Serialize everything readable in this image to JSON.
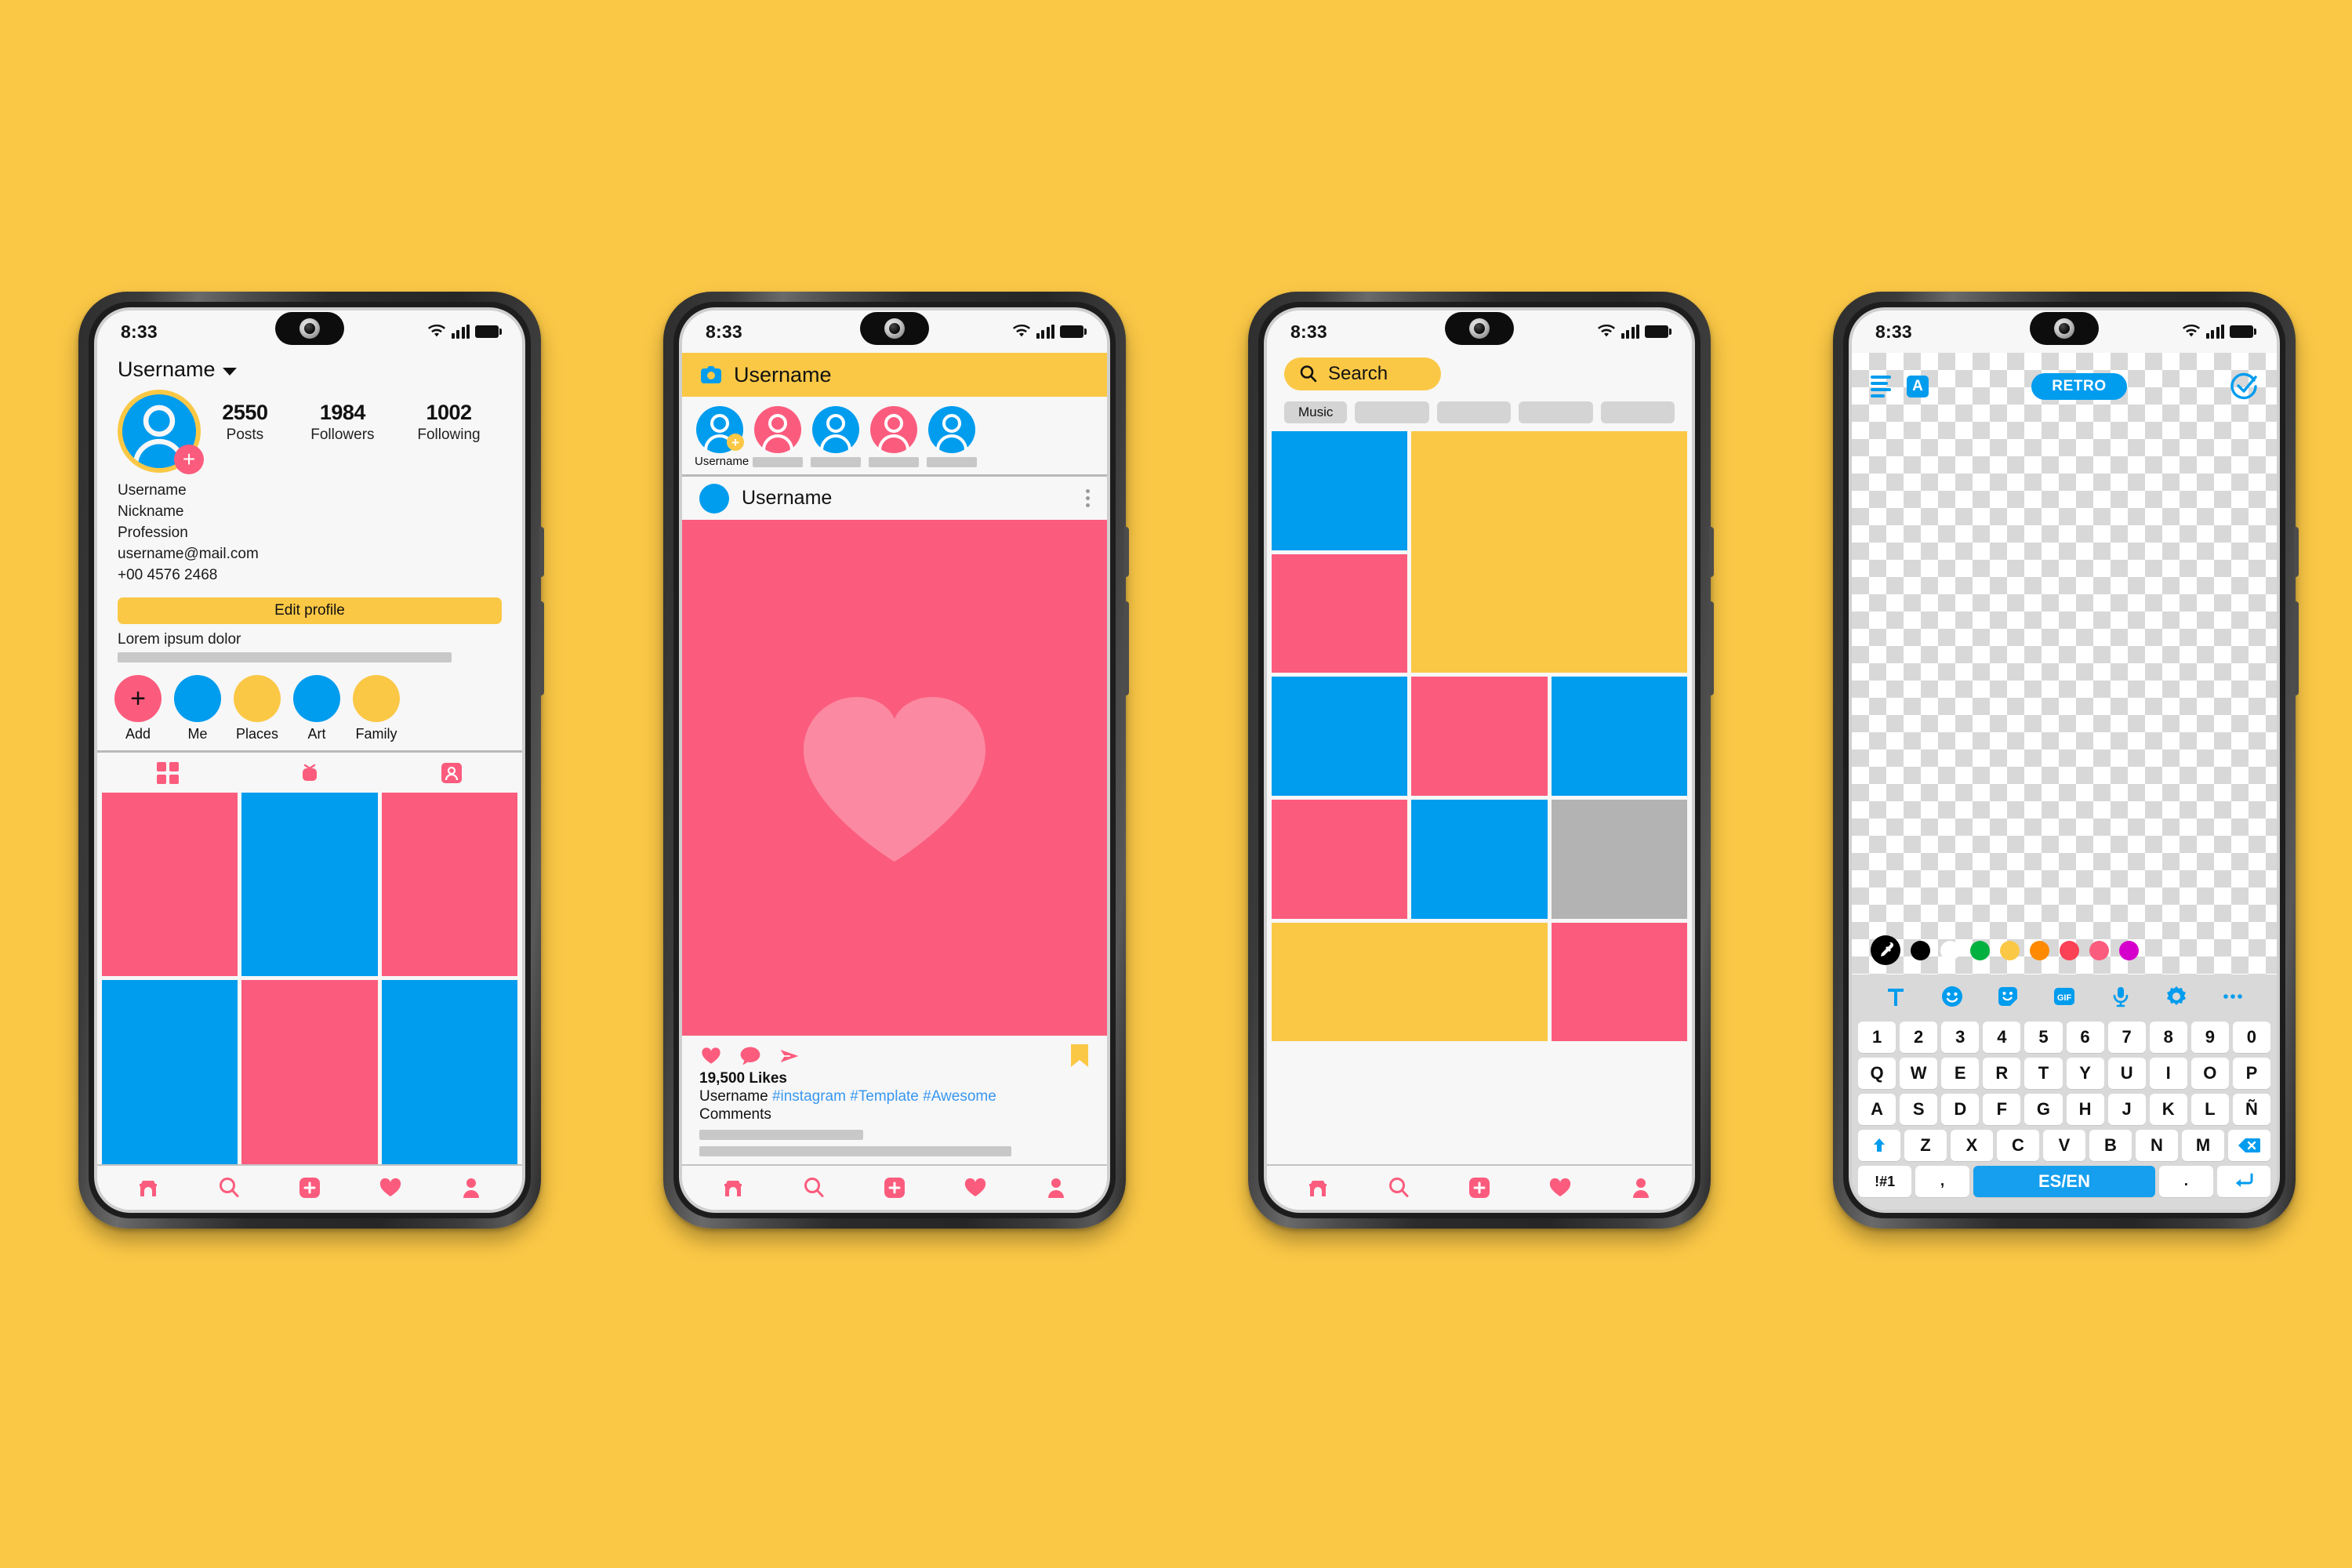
{
  "background_color": "#FBC846",
  "palette": {
    "yellow": "#FBC846",
    "pink": "#FB5C7D",
    "blue": "#009CEE",
    "gray": "#B3B3B3",
    "link_blue": "#3897F0"
  },
  "status_bar": {
    "time": "8:33",
    "icons": [
      "wifi-icon",
      "signal-icon",
      "battery-icon"
    ]
  },
  "phone1": {
    "name": "profile-screen",
    "username_header": "Username",
    "chevron": "chevron-down-icon",
    "avatar": {
      "icon": "user-avatar-icon",
      "add_badge": "+"
    },
    "stats": [
      {
        "number": "2550",
        "label": "Posts"
      },
      {
        "number": "1984",
        "label": "Followers"
      },
      {
        "number": "1002",
        "label": "Following"
      }
    ],
    "meta": [
      "Username",
      "Nickname",
      "Profession",
      "username@mail.com",
      "+00 4576 2468"
    ],
    "edit_button": "Edit profile",
    "bio_title": "Lorem ipsum dolor",
    "highlights": [
      {
        "label": "Add",
        "color": "#FB5C7D",
        "glyph": "+"
      },
      {
        "label": "Me",
        "color": "#009CEE",
        "glyph": ""
      },
      {
        "label": "Places",
        "color": "#FBC846",
        "glyph": ""
      },
      {
        "label": "Art",
        "color": "#009CEE",
        "glyph": ""
      },
      {
        "label": "Family",
        "color": "#FBC846",
        "glyph": ""
      }
    ],
    "tabs": [
      "grid-icon",
      "tv-icon",
      "tagged-person-icon"
    ],
    "grid_colors": [
      "#FB5C7D",
      "#009CEE",
      "#FB5C7D",
      "#009CEE",
      "#FB5C7D",
      "#009CEE"
    ],
    "bottom_nav": [
      "home-icon",
      "search-icon",
      "add-post-icon",
      "heart-icon",
      "profile-icon"
    ]
  },
  "phone2": {
    "name": "feed-screen",
    "header": {
      "icon": "camera-icon",
      "username": "Username"
    },
    "stories": [
      {
        "label": "Username",
        "color": "#009CEE",
        "has_add": true
      },
      {
        "label": "",
        "color": "#FB5C7D",
        "has_add": false
      },
      {
        "label": "",
        "color": "#009CEE",
        "has_add": false
      },
      {
        "label": "",
        "color": "#FB5C7D",
        "has_add": false
      },
      {
        "label": "",
        "color": "#009CEE",
        "has_add": false
      }
    ],
    "post": {
      "author": "Username",
      "menu_icon": "more-options-icon",
      "image_icon": "heart-shape",
      "image_bg": "#FB5C7D",
      "actions": [
        "like-heart-icon",
        "comment-icon",
        "share-icon",
        "bookmark-icon"
      ],
      "likes": "19,500 Likes",
      "caption_author": "Username",
      "hashtags": "#instagram #Template #Awesome",
      "comments_label": "Comments"
    },
    "bottom_nav": [
      "home-icon",
      "search-icon",
      "add-post-icon",
      "heart-icon",
      "profile-icon"
    ]
  },
  "phone3": {
    "name": "explore-screen",
    "search": {
      "icon": "search-icon",
      "text": "Search"
    },
    "chips": [
      "Music",
      "",
      "",
      "",
      ""
    ],
    "grid_tiles": [
      {
        "color": "#009CEE",
        "col": 1,
        "row": 1,
        "colspan": 1,
        "rowspan": 1
      },
      {
        "color": "#FBC846",
        "col": 2,
        "row": 1,
        "colspan": 2,
        "rowspan": 2
      },
      {
        "color": "#FB5C7D",
        "col": 1,
        "row": 2,
        "colspan": 1,
        "rowspan": 1
      },
      {
        "color": "#009CEE",
        "col": 1,
        "row": 3,
        "colspan": 1,
        "rowspan": 1
      },
      {
        "color": "#FB5C7D",
        "col": 2,
        "row": 3,
        "colspan": 1,
        "rowspan": 1
      },
      {
        "color": "#009CEE",
        "col": 3,
        "row": 3,
        "colspan": 1,
        "rowspan": 1
      },
      {
        "color": "#FB5C7D",
        "col": 1,
        "row": 4,
        "colspan": 1,
        "rowspan": 1
      },
      {
        "color": "#009CEE",
        "col": 2,
        "row": 4,
        "colspan": 1,
        "rowspan": 1
      },
      {
        "color": "#B3B3B3",
        "col": 3,
        "row": 4,
        "colspan": 1,
        "rowspan": 1
      },
      {
        "color": "#FBC846",
        "col": 1,
        "row": 5,
        "colspan": 2,
        "rowspan": 1
      },
      {
        "color": "#FB5C7D",
        "col": 3,
        "row": 5,
        "colspan": 1,
        "rowspan": 1
      }
    ],
    "bottom_nav": [
      "home-icon",
      "search-icon",
      "add-post-icon",
      "heart-icon",
      "profile-icon"
    ]
  },
  "phone4": {
    "name": "photo-editor-screen",
    "toolbar": {
      "menu_icon": "hamburger-menu-icon",
      "text_style_label": "A",
      "filter_label": "RETRO",
      "confirm_icon": "check-circle-icon"
    },
    "color_swatches": [
      {
        "name": "eyedropper",
        "color": "#000000",
        "icon": "eyedropper-icon"
      },
      {
        "name": "black",
        "color": "#000000"
      },
      {
        "name": "white",
        "color": "#FFFFFF"
      },
      {
        "name": "green",
        "color": "#00B140"
      },
      {
        "name": "yellow",
        "color": "#FBC846"
      },
      {
        "name": "orange",
        "color": "#FF8A00"
      },
      {
        "name": "red",
        "color": "#FB4155"
      },
      {
        "name": "pink",
        "color": "#FB5C7D"
      },
      {
        "name": "magenta",
        "color": "#D600CC"
      }
    ],
    "tool_icons": [
      "text-icon",
      "emoji-icon",
      "sticker-icon",
      "gif-icon",
      "microphone-icon",
      "settings-icon",
      "more-icon"
    ],
    "gif_label": "GIF",
    "keyboard": {
      "row1": [
        "1",
        "2",
        "3",
        "4",
        "5",
        "6",
        "7",
        "8",
        "9",
        "0"
      ],
      "row2": [
        "Q",
        "W",
        "E",
        "R",
        "T",
        "Y",
        "U",
        "I",
        "O",
        "P"
      ],
      "row3": [
        "A",
        "S",
        "D",
        "F",
        "G",
        "H",
        "J",
        "K",
        "L",
        "Ñ"
      ],
      "row4": [
        "shift-icon",
        "Z",
        "X",
        "C",
        "V",
        "B",
        "N",
        "M",
        "backspace-icon"
      ],
      "row5": [
        "!#1",
        ",",
        "ES/EN",
        ".",
        "enter-icon"
      ]
    }
  }
}
